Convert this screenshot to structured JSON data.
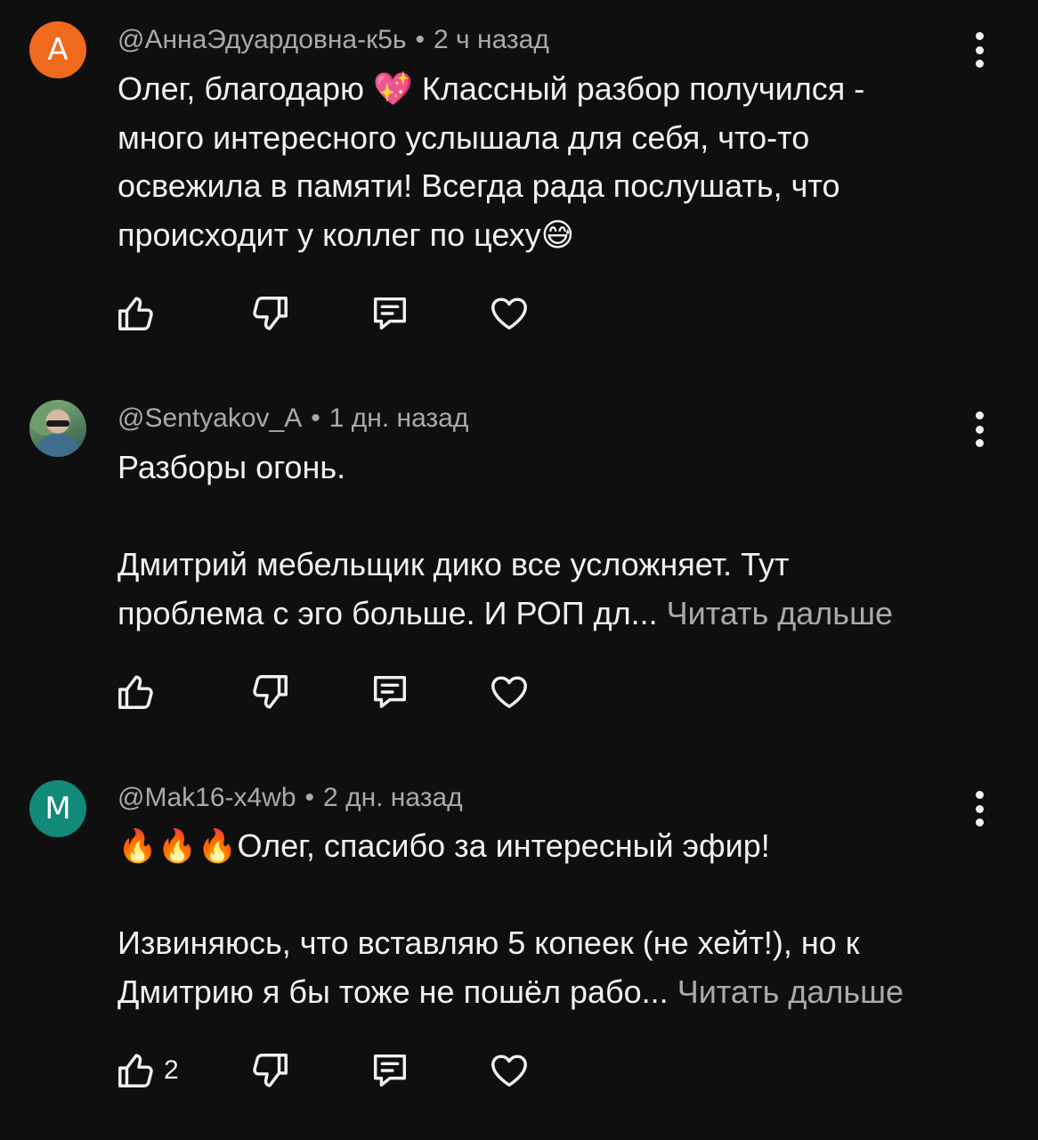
{
  "comments": [
    {
      "avatar_letter": "А",
      "avatar_color": "#f06a1e",
      "author": "@АннаЭдуардовна-к5ь",
      "separator": "•",
      "time": "2 ч назад",
      "lines": [
        "Олег, благодарю 💖 Классный разбор получился -",
        "много интересного услышала для себя, что-то",
        "освежила в памяти! Всегда рада послушать, что",
        "происходит у коллег по цеху😅"
      ],
      "like_count": ""
    },
    {
      "avatar_letter": "",
      "avatar_color": "#5a8a6a",
      "author": "@Sentyakov_A",
      "separator": "•",
      "time": "1 дн. назад",
      "lines": [
        "Разборы огонь.",
        "",
        "Дмитрий мебельщик дико все усложняет. Тут",
        "проблема с эго больше. И РОП дл..."
      ],
      "read_more": "Читать дальше",
      "like_count": ""
    },
    {
      "avatar_letter": "М",
      "avatar_color": "#128a78",
      "author": "@Mak16-x4wb",
      "separator": "•",
      "time": "2 дн. назад",
      "lines": [
        "🔥🔥🔥Олег, спасибо за интересный эфир!",
        "",
        "Извиняюсь, что вставляю 5 копеек (не хейт!), но к",
        "Дмитрию я бы тоже не пошёл рабо..."
      ],
      "read_more": "Читать дальше",
      "like_count": "2"
    }
  ],
  "icons": {
    "like": "thumb-up-icon",
    "dislike": "thumb-down-icon",
    "reply": "reply-comment-icon",
    "heart": "heart-icon",
    "menu": "more-vertical-icon"
  },
  "colors": {
    "background": "#0f0f0f",
    "text": "#f1f1f1",
    "secondary_text": "#aaaaaa"
  }
}
